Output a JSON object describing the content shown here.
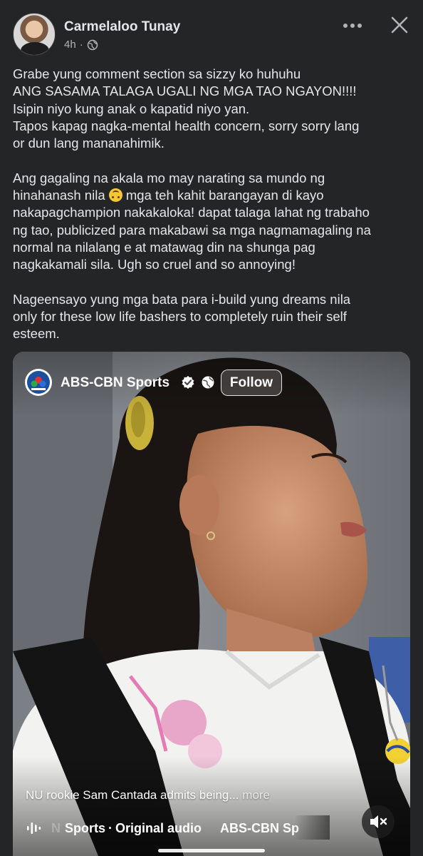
{
  "post": {
    "author": "Carmelaloo Tunay",
    "time": "4h",
    "dot": "·",
    "icons": {
      "privacy": "globe-icon",
      "more": "more-options-icon",
      "close": "close-icon"
    },
    "text_lines": [
      "Grabe yung comment section sa sizzy ko huhuhu",
      "ANG SASAMA TALAGA UGALI NG MGA TAO NGAYON!!!!",
      "Isipin niyo kung anak o kapatid niyo yan.",
      "Tapos kapag nagka-mental health concern, sorry sorry lang",
      "or dun lang mananahimik.",
      "",
      "Ang gagaling na akala mo may narating sa mundo ng",
      "hinahanash nila",
      " mga teh kahit barangayan di kayo",
      "nakapagchampion nakakaloka! dapat talaga lahat ng trabaho",
      "ng tao, publicized para makabawi sa mga nagmamagaling na",
      "normal na nilalang e at matawag din na shunga pag",
      "nagkakamali sila. Ugh so cruel and so annoying!",
      "",
      "Nageensayo yung mga bata para i-build yung dreams nila",
      "only for these low life bashers to completely ruin their self",
      "esteem."
    ],
    "emoji": "upside-down-face-emoji"
  },
  "video": {
    "page_name": "ABS-CBN Sports",
    "follow_label": "Follow",
    "caption": "NU rookie Sam Cantada admits being...",
    "caption_more": "more",
    "audio_prefix": "N",
    "audio_source": "Sports",
    "audio_dot": "·",
    "audio_label": "Original audio",
    "audio_scroll": "ABS-CBN Sp",
    "icons": {
      "logo": "abs-cbn-logo-icon",
      "verified": "verified-badge-icon",
      "globe": "globe-icon",
      "audio": "audio-bars-icon",
      "mute": "muted-speaker-icon"
    }
  },
  "colors": {
    "background": "#242526",
    "text": "#e4e6eb",
    "secondary": "#b0b3b8"
  }
}
